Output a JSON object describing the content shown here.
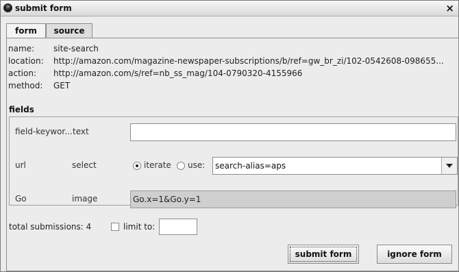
{
  "window": {
    "title": "submit form",
    "close_label": "×"
  },
  "tabs": [
    {
      "label": "form",
      "active": true
    },
    {
      "label": "source",
      "active": false
    }
  ],
  "info": {
    "name_label": "name:",
    "name_value": "site-search",
    "location_label": "location:",
    "location_value": "http://amazon.com/magazine-newspaper-subscriptions/b/ref=gw_br_zi/102-0542608-098655...",
    "action_label": "action:",
    "action_value": "http://amazon.com/s/ref=nb_ss_mag/104-0790320-4155966",
    "method_label": "method:",
    "method_value": "GET"
  },
  "fields_heading": "fields",
  "fields": [
    {
      "name": "field-keywor...",
      "type": "text",
      "value": ""
    },
    {
      "name": "url",
      "type": "select",
      "iterate_label": "iterate",
      "use_label": "use:",
      "selected_mode": "iterate",
      "select_value": "search-alias=aps"
    },
    {
      "name": "Go",
      "type": "image",
      "value": "Go.x=1&Go.y=1"
    }
  ],
  "footer": {
    "total_label": "total submissions: 4",
    "limit_label": "limit to:",
    "limit_checked": false,
    "limit_value": ""
  },
  "buttons": {
    "submit_label": "submit form",
    "ignore_label": "ignore form"
  }
}
